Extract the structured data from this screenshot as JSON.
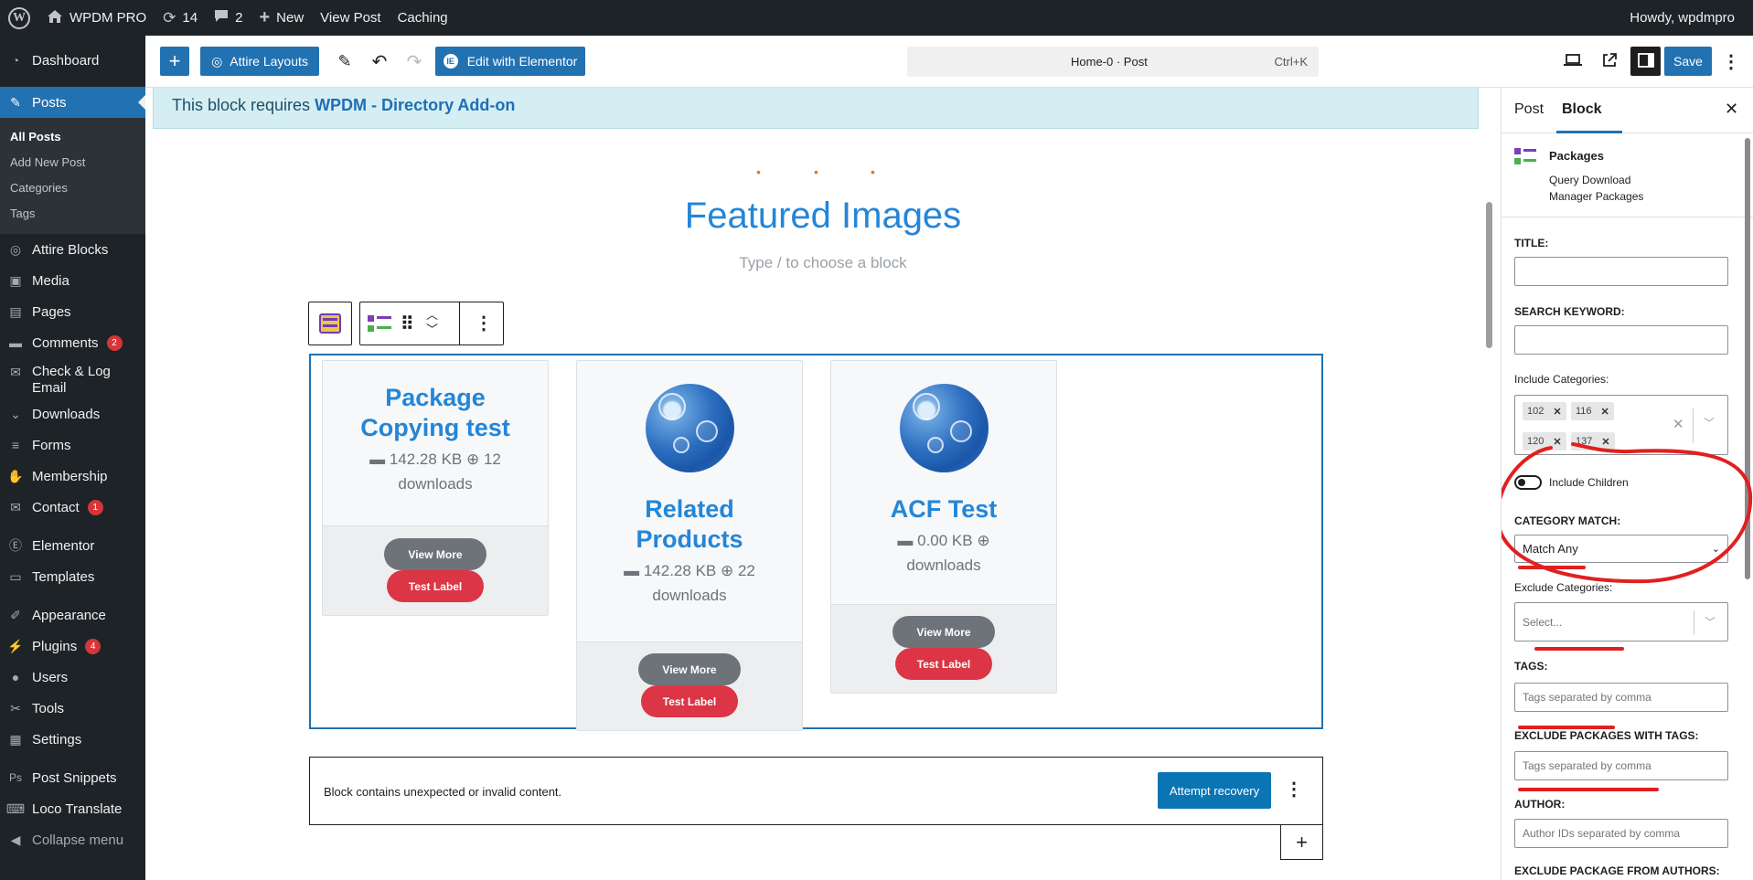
{
  "adminbar": {
    "site_name": "WPDM PRO",
    "updates": "14",
    "comments": "2",
    "new_label": "New",
    "view_post": "View Post",
    "caching": "Caching",
    "howdy": "Howdy, wpdmpro"
  },
  "sidebar": {
    "dashboard": "Dashboard",
    "posts": "Posts",
    "posts_sub": [
      "All Posts",
      "Add New Post",
      "Categories",
      "Tags"
    ],
    "attire_blocks": "Attire Blocks",
    "media": "Media",
    "pages": "Pages",
    "comments": "Comments",
    "comments_badge": "2",
    "check_log_email": "Check & Log Email",
    "downloads": "Downloads",
    "forms": "Forms",
    "membership": "Membership",
    "contact": "Contact",
    "contact_badge": "1",
    "elementor": "Elementor",
    "templates": "Templates",
    "appearance": "Appearance",
    "plugins": "Plugins",
    "plugins_badge": "4",
    "users": "Users",
    "tools": "Tools",
    "settings": "Settings",
    "post_snippets": "Post Snippets",
    "loco_translate": "Loco Translate",
    "collapse": "Collapse menu"
  },
  "toolbar": {
    "attire_layouts": "Attire Layouts",
    "edit_elementor": "Edit with Elementor",
    "doc_title": "Home-0 · Post",
    "shortcut": "Ctrl+K",
    "save": "Save"
  },
  "canvas": {
    "notice_prefix": "This block requires ",
    "notice_link": "WPDM - Directory Add-on",
    "featured_title": "Featured Images",
    "placeholder": "Type / to choose a block",
    "cards": [
      {
        "title_line1": "Package",
        "title_line2": "Copying test",
        "size": "142.28 KB",
        "downloads_count": "12",
        "downloads_label": "downloads",
        "view_more": "View More",
        "test_label": "Test Label"
      },
      {
        "title_line1": "Related",
        "title_line2": "Products",
        "size": "142.28 KB",
        "downloads_count": "22",
        "downloads_label": "downloads",
        "view_more": "View More",
        "test_label": "Test Label"
      },
      {
        "title_line1": "ACF Test",
        "size": "0.00 KB",
        "downloads_count": "",
        "downloads_label": "downloads",
        "view_more": "View More",
        "test_label": "Test Label"
      }
    ],
    "invalid_text": "Block contains unexpected or invalid content.",
    "attempt_recovery": "Attempt recovery"
  },
  "panel": {
    "tab_post": "Post",
    "tab_block": "Block",
    "block_name": "Packages",
    "block_desc_line1": "Query Download",
    "block_desc_line2": "Manager Packages",
    "title_label": "TITLE:",
    "search_label": "SEARCH KEYWORD:",
    "include_cat_label": "Include Categories:",
    "include_cats": [
      "102",
      "116",
      "120",
      "137"
    ],
    "include_children": "Include Children",
    "category_match_label": "CATEGORY MATCH:",
    "category_match_value": "Match Any",
    "exclude_cat_label": "Exclude Categories:",
    "exclude_cat_placeholder": "Select...",
    "tags_label": "TAGS:",
    "tags_placeholder": "Tags separated by comma",
    "exclude_tags_label": "EXCLUDE PACKAGES WITH TAGS:",
    "exclude_tags_placeholder": "Tags separated by comma",
    "author_label": "AUTHOR:",
    "author_placeholder": "Author IDs separated by comma",
    "exclude_authors_label": "EXCLUDE PACKAGE FROM AUTHORS:"
  },
  "colors": {
    "admin_dark": "#1d2327",
    "wp_blue": "#2271b1",
    "title_blue": "#2386d8",
    "annotation_red": "#e02020",
    "button_red": "#dc3545",
    "button_gray": "#6d7379"
  }
}
